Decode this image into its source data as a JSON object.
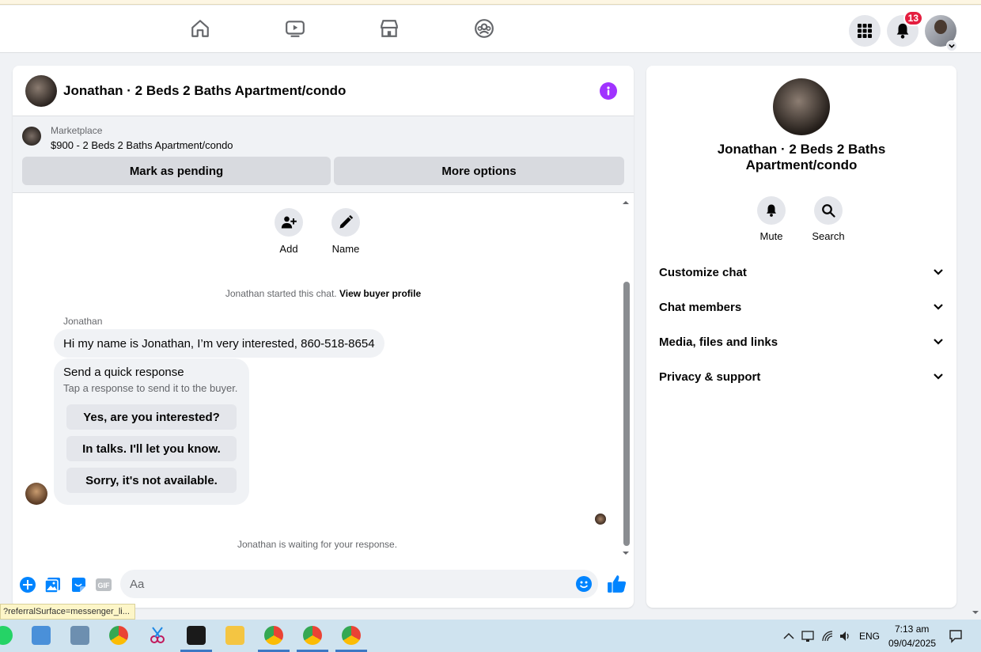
{
  "topnav": {
    "notification_count": "13"
  },
  "chat": {
    "title": "Jonathan · 2 Beds 2 Baths Apartment/condo",
    "marketplace_label": "Marketplace",
    "listing": "$900 - 2 Beds 2 Baths Apartment/condo",
    "mark_pending": "Mark as pending",
    "more_options": "More options",
    "actions": {
      "add": "Add",
      "name": "Name"
    },
    "started_prefix": "Jonathan started this chat.",
    "view_profile": "View buyer profile",
    "sender": "Jonathan",
    "message": "Hi my name is Jonathan, I’m very interested, 860-518-8654",
    "quick_title": "Send a quick response",
    "quick_sub": "Tap a response to send it to the buyer.",
    "quick_replies": [
      "Yes, are you interested?",
      "In talks. I'll let you know.",
      "Sorry, it's not available."
    ],
    "waiting": "Jonathan is waiting for your response.",
    "composer_placeholder": "Aa",
    "gif_label": "GIF"
  },
  "side": {
    "name": "Jonathan · 2 Beds 2 Baths Apartment/condo",
    "mute": "Mute",
    "search": "Search",
    "sections": [
      "Customize chat",
      "Chat members",
      "Media, files and links",
      "Privacy & support"
    ]
  },
  "status_tooltip": "?referralSurface=messenger_li...",
  "taskbar": {
    "lang": "ENG",
    "time": "7:13 am",
    "date": "09/04/2025"
  },
  "colors": {
    "accent": "#0084ff",
    "info": "#a033ff",
    "badge": "#e41e3f"
  }
}
